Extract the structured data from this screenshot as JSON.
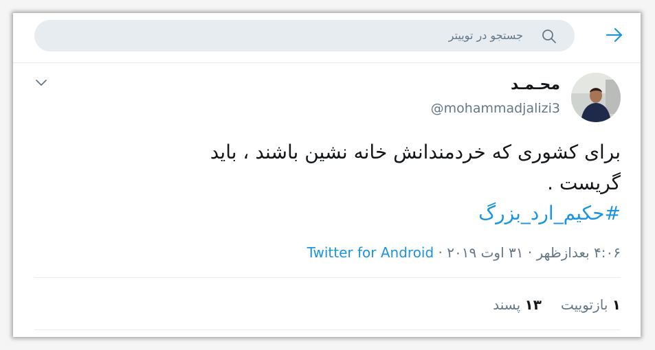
{
  "search": {
    "placeholder": "جستجو در توییتر"
  },
  "tweet": {
    "author_name": "محـمـد",
    "handle": "@mohammadjalizi3",
    "text_line1": "برای کشوری که خردمندانش خانه نشین باشند ، باید",
    "text_line2": "گریست .",
    "hashtag": "#حکیم_ارد_بزرگ",
    "time": "۴:۰۶ بعدازظهر",
    "date": "۳۱ اوت ۲۰۱۹",
    "separator": "·",
    "source": "Twitter for Android",
    "retweets_count": "۱",
    "retweets_label": "بازتوییت",
    "likes_count": "۱۳",
    "likes_label": "پسند"
  },
  "icons": {
    "back": "arrow-right-icon",
    "search": "search-icon",
    "more": "chevron-down-icon"
  },
  "colors": {
    "accent": "#1b95e0",
    "muted": "#657786",
    "search_bg": "#e6ecf0"
  }
}
